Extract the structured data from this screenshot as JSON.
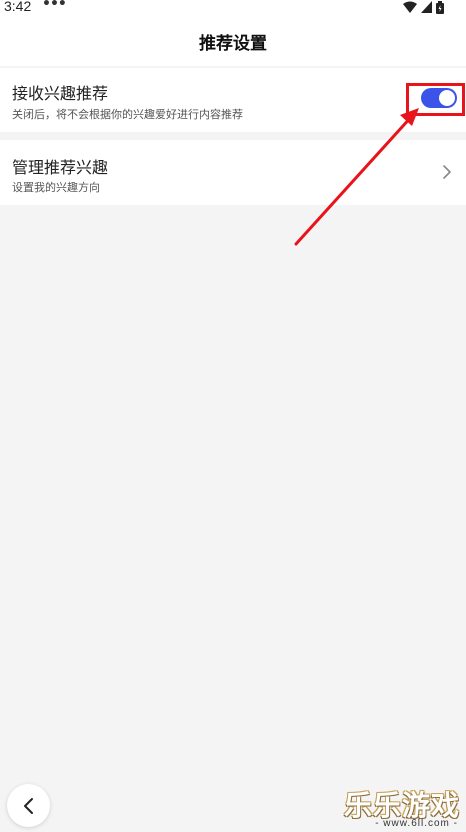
{
  "status_bar": {
    "time": "3:42",
    "dots": "•••"
  },
  "nav": {
    "title": "推荐设置"
  },
  "settings": [
    {
      "title": "接收兴趣推荐",
      "subtitle": "关闭后，将不会根据你的兴趣爱好进行内容推荐",
      "toggle_on": true
    },
    {
      "title": "管理推荐兴趣",
      "subtitle": "设置我的兴趣方向"
    }
  ],
  "watermark": {
    "main": "乐乐游戏",
    "sub": "- www.6ll.com -"
  },
  "colors": {
    "toggle_on": "#3b53e8",
    "annotation": "#e8131b"
  },
  "icons": {
    "back": "chevron-left-icon",
    "row_chevron": "chevron-right-icon",
    "wifi": "wifi-icon",
    "signal": "signal-icon",
    "battery": "battery-icon"
  }
}
